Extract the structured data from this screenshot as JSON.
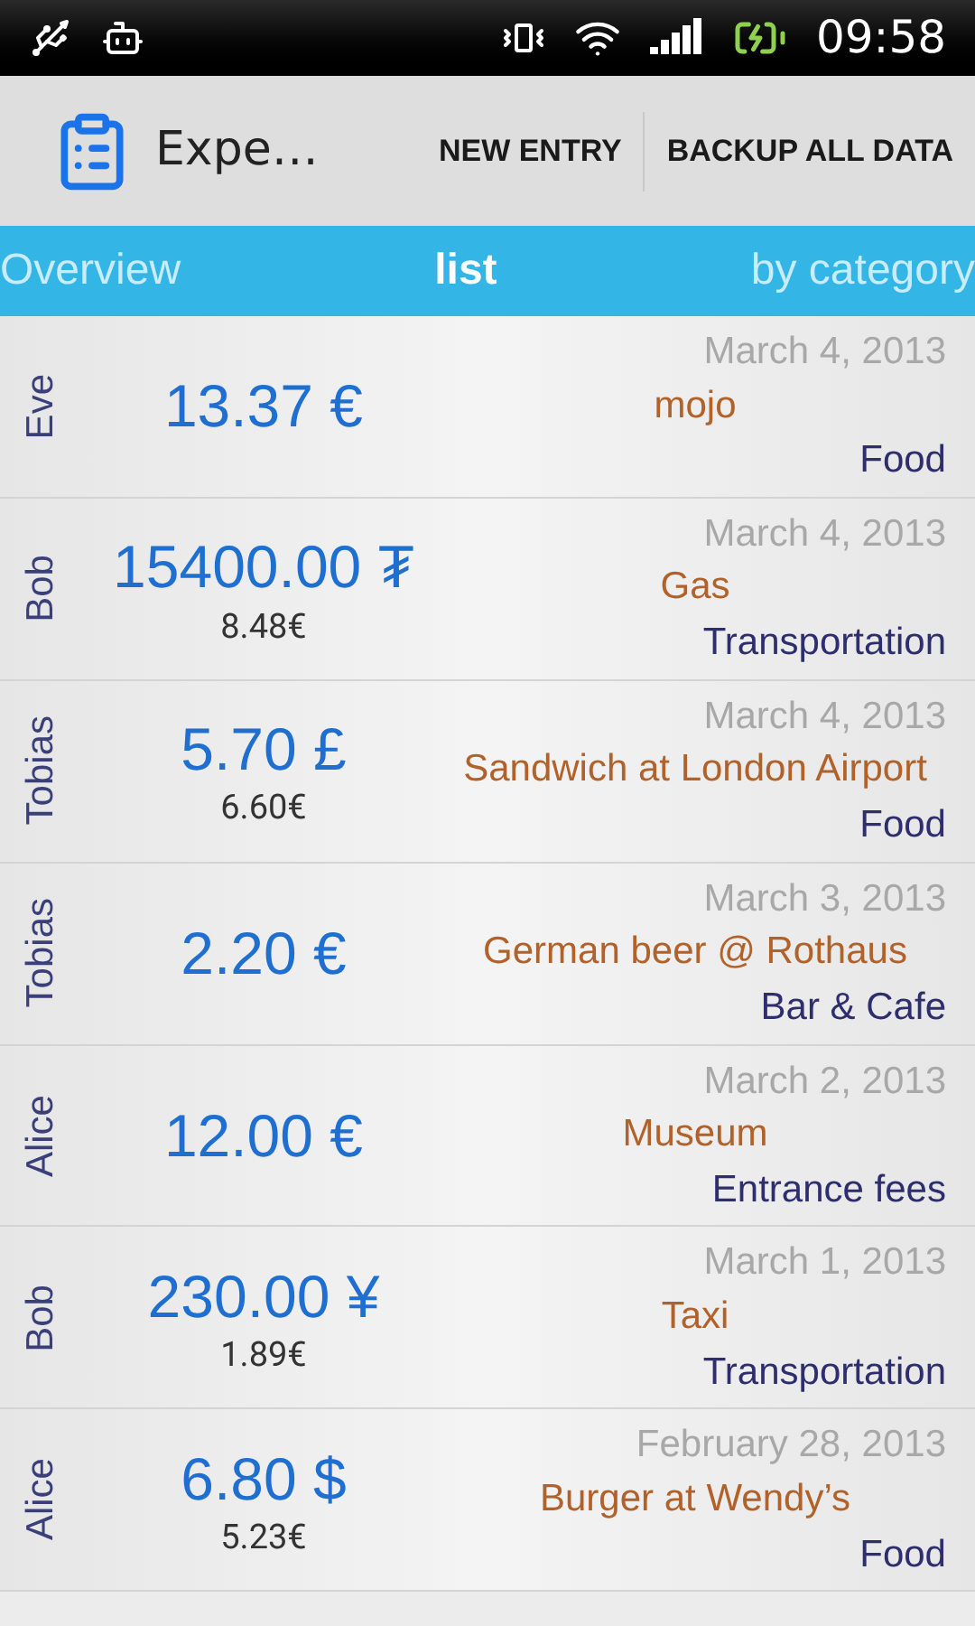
{
  "status_bar": {
    "time": "09:58"
  },
  "action_bar": {
    "title": "Expe…",
    "actions": [
      "NEW ENTRY",
      "BACKUP ALL DATA"
    ]
  },
  "tabs": [
    {
      "label": "Overview",
      "selected": false
    },
    {
      "label": "list",
      "selected": true
    },
    {
      "label": "by category",
      "selected": false
    }
  ],
  "entries": [
    {
      "person": "Eve",
      "amount": "13.37 €",
      "date": "March 4, 2013",
      "description": "mojo",
      "category": "Food"
    },
    {
      "person": "Bob",
      "amount": "15400.00 ₮",
      "converted": "8.48€",
      "date": "March 4, 2013",
      "description": "Gas",
      "category": "Transportation"
    },
    {
      "person": "Tobias",
      "amount": "5.70 £",
      "converted": "6.60€",
      "date": "March 4, 2013",
      "description": "Sandwich at London Airport",
      "category": "Food"
    },
    {
      "person": "Tobias",
      "amount": "2.20 €",
      "date": "March 3, 2013",
      "description": "German beer @ Rothaus",
      "category": "Bar & Cafe"
    },
    {
      "person": "Alice",
      "amount": "12.00 €",
      "date": "March 2, 2013",
      "description": "Museum",
      "category": "Entrance fees"
    },
    {
      "person": "Bob",
      "amount": "230.00 ¥",
      "converted": "1.89€",
      "date": "March 1, 2013",
      "description": "Taxi",
      "category": "Transportation"
    },
    {
      "person": "Alice",
      "amount": "6.80 $",
      "converted": "5.23€",
      "date": "February 28, 2013",
      "description": "Burger at Wendy’s",
      "category": "Food"
    }
  ]
}
